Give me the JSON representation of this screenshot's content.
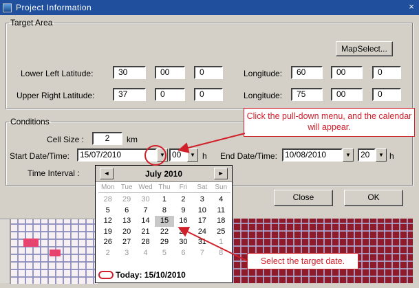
{
  "window": {
    "title": "Project Information",
    "close_glyph": "×"
  },
  "target_area": {
    "legend": "Target Area",
    "map_select_label": "MapSelect...",
    "lower_left_lat_label": "Lower Left Latitude:",
    "lower_left_lat": [
      "30",
      "00",
      "0"
    ],
    "lower_left_lon_label": "Longitude:",
    "lower_left_lon": [
      "60",
      "00",
      "0"
    ],
    "upper_right_lat_label": "Upper Right Latitude:",
    "upper_right_lat": [
      "37",
      "0",
      "0"
    ],
    "upper_right_lon_label": "Longitude:",
    "upper_right_lon": [
      "75",
      "00",
      "0"
    ]
  },
  "conditions": {
    "legend": "Conditions",
    "cell_size_label": "Cell Size :",
    "cell_size": "2",
    "cell_size_unit": "km",
    "start_label": "Start Date/Time:",
    "start_date": "15/07/2010",
    "start_hour": "00",
    "start_hour_unit": "h",
    "end_label": "End Date/Time:",
    "end_date": "10/08/2010",
    "end_hour": "20",
    "end_hour_unit": "h",
    "interval_label": "Time Interval :"
  },
  "buttons": {
    "close": "Close",
    "ok": "OK"
  },
  "calendar": {
    "month_label": "July 2010",
    "prev_glyph": "◄",
    "next_glyph": "►",
    "weekdays": [
      "Mon",
      "Tue",
      "Wed",
      "Thu",
      "Fri",
      "Sat",
      "Sun"
    ],
    "weeks": [
      [
        "28",
        "29",
        "30",
        "1",
        "2",
        "3",
        "4"
      ],
      [
        "5",
        "6",
        "7",
        "8",
        "9",
        "10",
        "11"
      ],
      [
        "12",
        "13",
        "14",
        "15",
        "16",
        "17",
        "18"
      ],
      [
        "19",
        "20",
        "21",
        "22",
        "23",
        "24",
        "25"
      ],
      [
        "26",
        "27",
        "28",
        "29",
        "30",
        "31",
        "1"
      ],
      [
        "2",
        "3",
        "4",
        "5",
        "6",
        "7",
        "8"
      ]
    ],
    "selected_day": "15",
    "today_label": "Today: 15/10/2010"
  },
  "callouts": {
    "pulldown": "Click the pull-down menu, and the calendar will appear.",
    "select": "Select the target date."
  },
  "colors": {
    "annotation": "#d0202a",
    "title_bar": "#1f4f9d",
    "map_dark": "#8e1a2a"
  }
}
